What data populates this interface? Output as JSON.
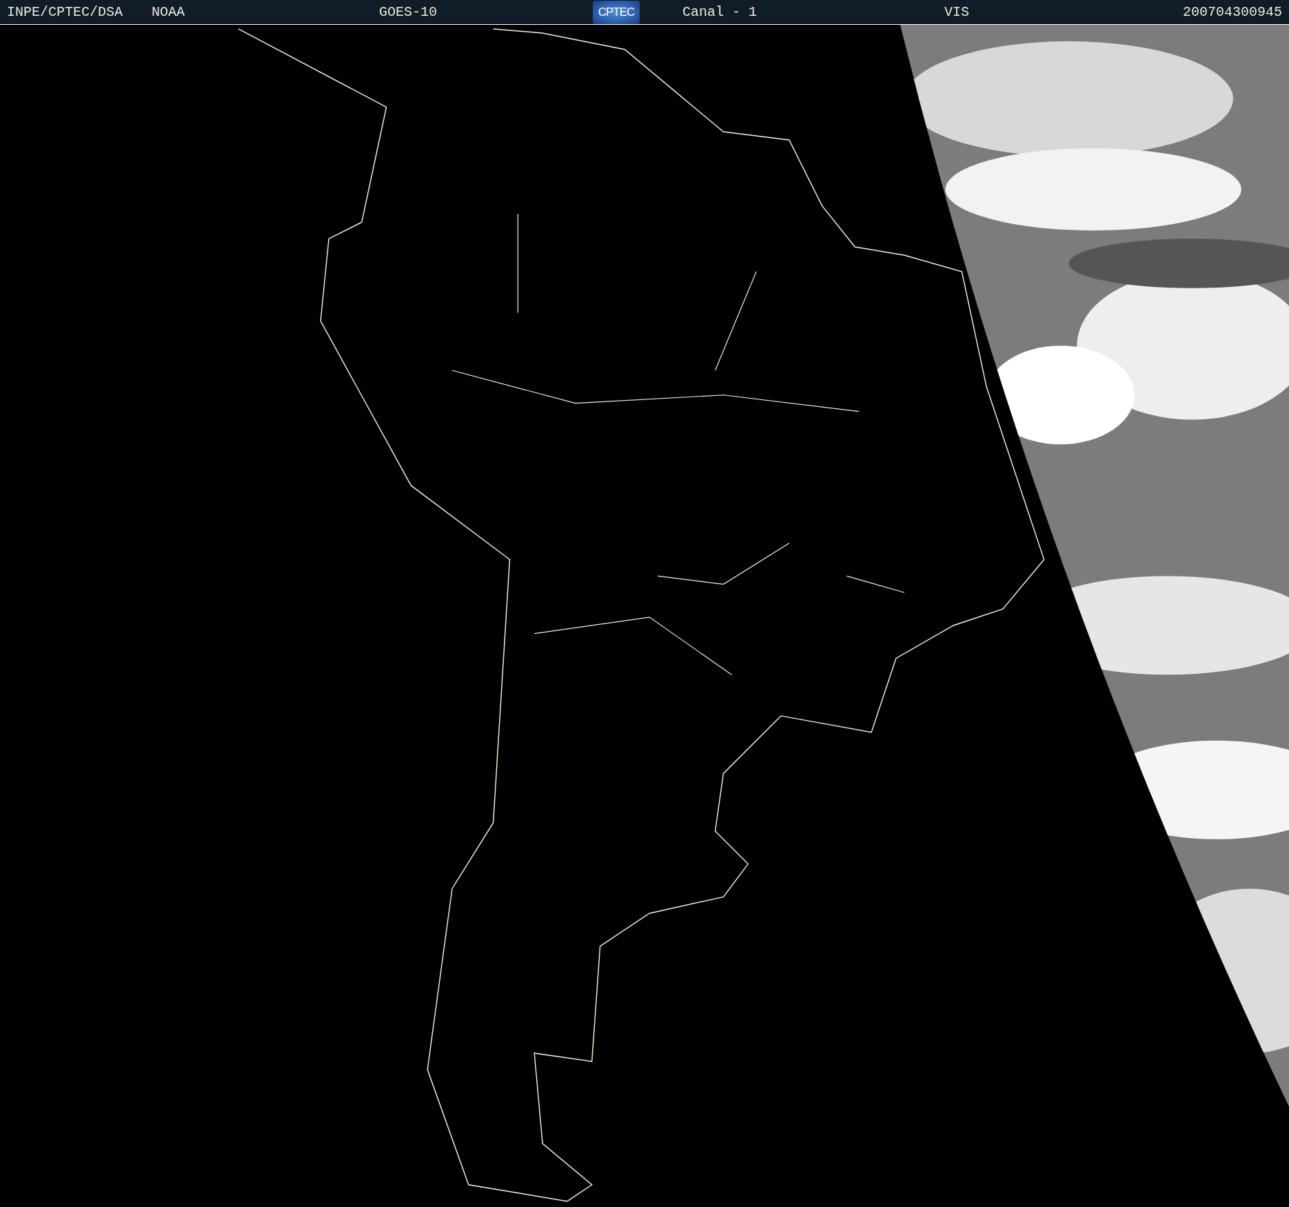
{
  "header": {
    "items": [
      {
        "kind": "text",
        "text": "INPE/CPTEC/DSA"
      },
      {
        "kind": "text",
        "text": "NOAA"
      },
      {
        "kind": "text",
        "text": "GOES-10"
      },
      {
        "kind": "logo",
        "text": "CPTEC"
      },
      {
        "kind": "text",
        "text": "Canal - 1"
      },
      {
        "kind": "text",
        "text": "VIS"
      },
      {
        "kind": "text",
        "text": "200704300945"
      }
    ]
  }
}
